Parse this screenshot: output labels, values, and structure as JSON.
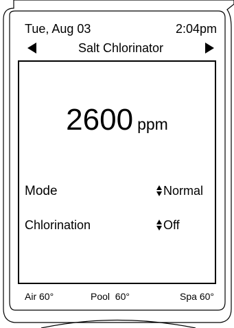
{
  "header": {
    "date": "Tue, Aug 03",
    "time": "2:04pm",
    "title": "Salt Chlorinator"
  },
  "reading": {
    "value": "2600",
    "unit": "ppm"
  },
  "settings": {
    "mode": {
      "label": "Mode",
      "value": "Normal"
    },
    "chlorination": {
      "label": "Chlorination",
      "value": "Off"
    }
  },
  "status": {
    "air": "Air 60°",
    "pool": "Pool  60°",
    "spa": "Spa 60°"
  }
}
